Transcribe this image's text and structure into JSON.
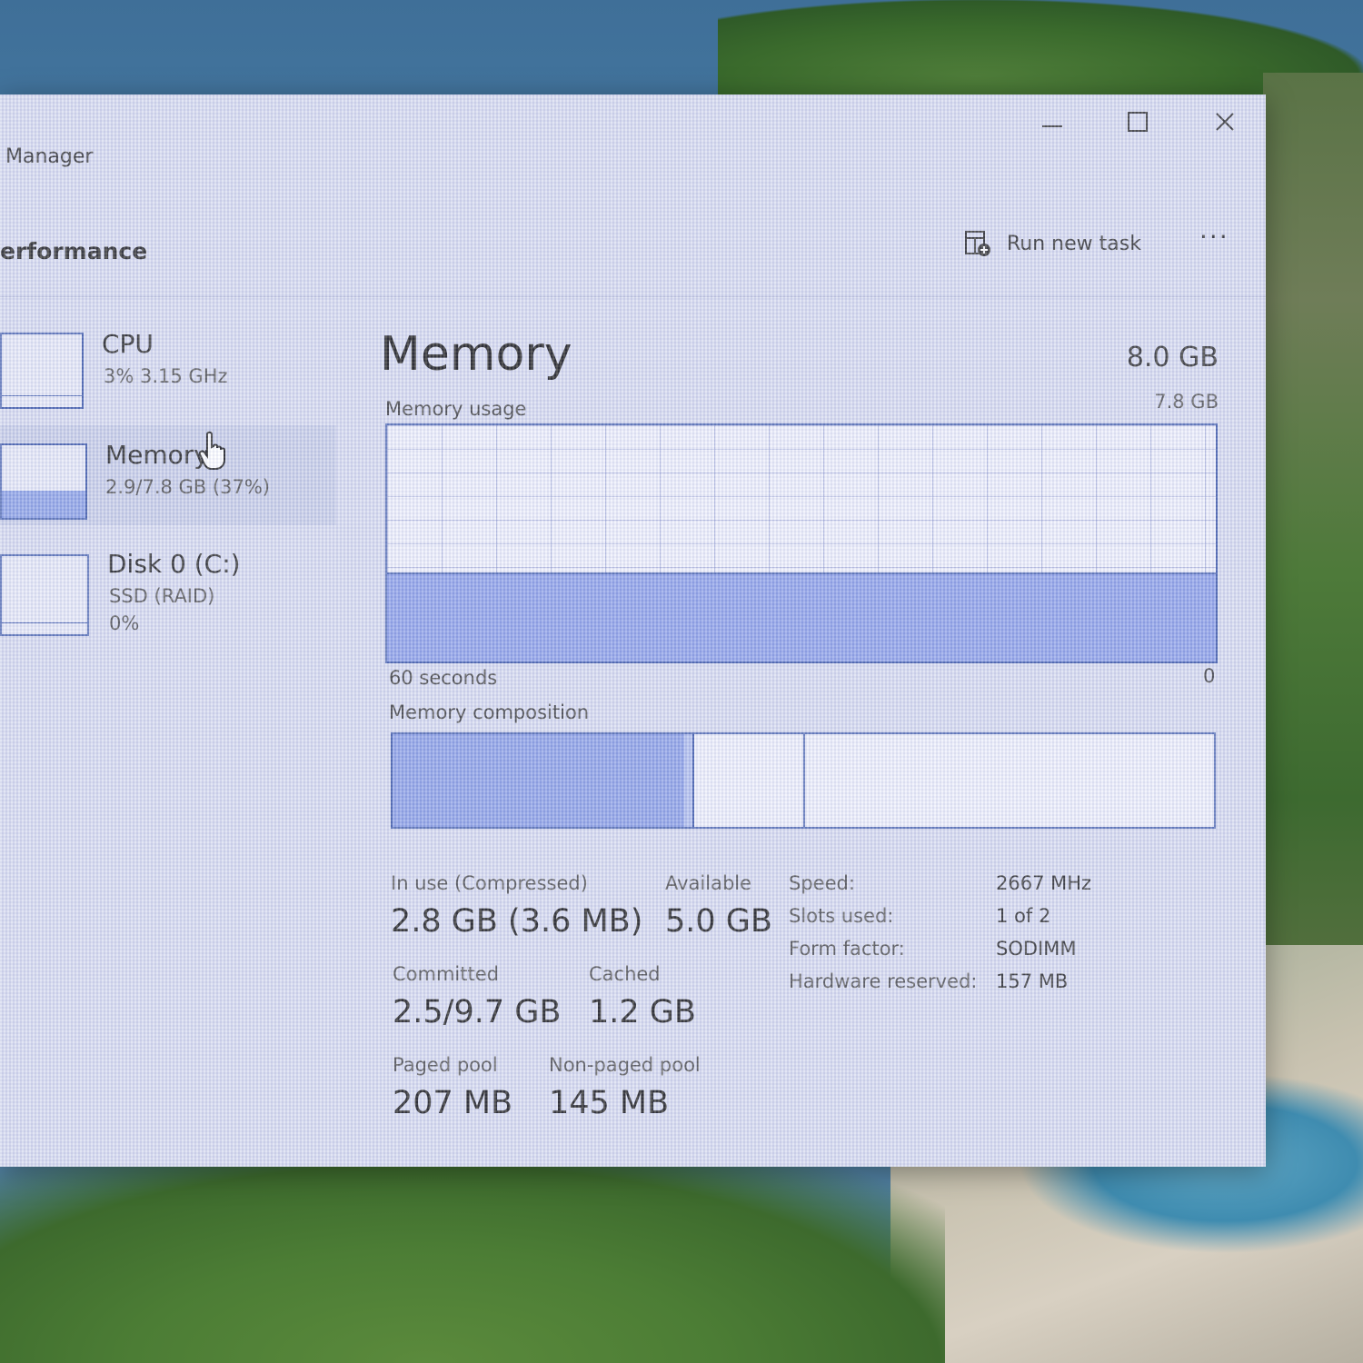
{
  "window": {
    "title": "Manager",
    "section": "erformance",
    "run_new_task": "Run new task",
    "more": "···"
  },
  "sidebar": {
    "items": [
      {
        "name": "CPU",
        "sub1": "3%  3.15 GHz"
      },
      {
        "name": "Memory",
        "sub1": "2.9/7.8 GB (37%)",
        "usage_percent": 37
      },
      {
        "name": "Disk 0 (C:)",
        "sub1": "SSD (RAID)",
        "sub2": "0%"
      }
    ]
  },
  "memory": {
    "title": "Memory",
    "total": "8.0 GB",
    "usage_label": "Memory usage",
    "usage_max": "7.8 GB",
    "usage_fraction": 0.37,
    "axis_left": "60 seconds",
    "axis_right": "0",
    "composition_label": "Memory composition",
    "composition": {
      "in_use_fraction": 0.355,
      "modified_fraction": 0.01,
      "standby_fraction": 0.135
    },
    "stats": {
      "in_use_label": "In use (Compressed)",
      "in_use_value": "2.8 GB (3.6 MB)",
      "available_label": "Available",
      "available_value": "5.0 GB",
      "committed_label": "Committed",
      "committed_value": "2.5/9.7 GB",
      "cached_label": "Cached",
      "cached_value": "1.2 GB",
      "paged_label": "Paged pool",
      "paged_value": "207 MB",
      "nonpaged_label": "Non-paged pool",
      "nonpaged_value": "145 MB"
    },
    "specs": [
      {
        "label": "Speed:",
        "value": "2667 MHz"
      },
      {
        "label": "Slots used:",
        "value": "1 of 2"
      },
      {
        "label": "Form factor:",
        "value": "SODIMM"
      },
      {
        "label": "Hardware reserved:",
        "value": "157 MB"
      }
    ]
  },
  "colors": {
    "accent": "#4a64b0",
    "fill": "#8fa2e8"
  }
}
